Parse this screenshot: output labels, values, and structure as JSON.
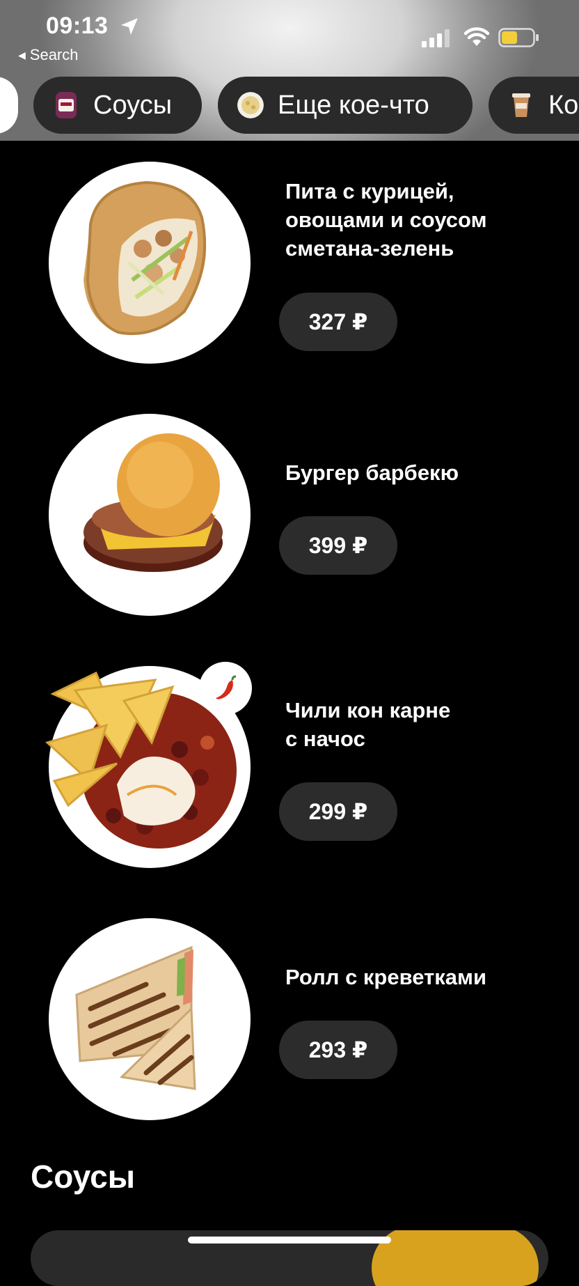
{
  "status_bar": {
    "time": "09:13",
    "back_label": "Search",
    "icons": [
      "location-arrow-icon",
      "cellular-signal-icon",
      "wifi-icon",
      "battery-icon"
    ],
    "battery_color": "#f2cf3a"
  },
  "categories": [
    {
      "label": "",
      "icon": "category-icon",
      "selected": false
    },
    {
      "label": "Соусы",
      "icon": "ketchup-bottle-icon"
    },
    {
      "label": "Еще кое-что",
      "icon": "cheese-plate-icon"
    },
    {
      "label": "Ко",
      "icon": "coffee-cup-icon"
    }
  ],
  "products": [
    {
      "name": "Пита с курицей, овощами и соусом сметана-зелень",
      "name_lines": [
        "Пита с курицей,",
        "овощами и соусом",
        "сметана-зелень"
      ],
      "price": "327 ₽",
      "image": "pita-image"
    },
    {
      "name": "Бургер барбекю",
      "name_lines": [
        "Бургер барбекю"
      ],
      "price": "399 ₽",
      "image": "burger-image"
    },
    {
      "name": "Чили кон карне с начос",
      "name_lines": [
        "Чили кон карне",
        "с начос"
      ],
      "price": "299 ₽",
      "image": "chili-nachos-image",
      "badge": "chili-pepper-icon"
    },
    {
      "name": "Ролл с креветками",
      "name_lines": [
        "Ролл с креветками"
      ],
      "price": "293 ₽",
      "image": "shrimp-roll-image"
    }
  ],
  "next_section": {
    "title": "Соусы"
  },
  "colors": {
    "background": "#000000",
    "chip": "#2a2a2a",
    "price_pill": "#2c2c2c"
  }
}
